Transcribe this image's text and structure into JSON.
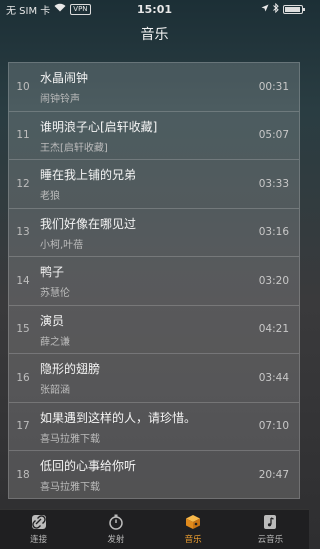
{
  "status": {
    "carrier": "无 SIM 卡",
    "vpn": "VPN",
    "time": "15:01"
  },
  "nav": {
    "title": "音乐"
  },
  "songs": [
    {
      "num": "10",
      "title": "水晶闹钟",
      "artist": "闹钟铃声",
      "duration": "00:31"
    },
    {
      "num": "11",
      "title": "谁明浪子心[启轩收藏]",
      "artist": "王杰[启轩收藏]",
      "duration": "05:07"
    },
    {
      "num": "12",
      "title": "睡在我上铺的兄弟",
      "artist": "老狼",
      "duration": "03:33"
    },
    {
      "num": "13",
      "title": "我们好像在哪见过",
      "artist": "小柯,叶蓓",
      "duration": "03:16"
    },
    {
      "num": "14",
      "title": "鸭子",
      "artist": "苏慧伦",
      "duration": "03:20"
    },
    {
      "num": "15",
      "title": "演员",
      "artist": "薛之谦",
      "duration": "04:21"
    },
    {
      "num": "16",
      "title": "隐形的翅膀",
      "artist": "张韶涵",
      "duration": "03:44"
    },
    {
      "num": "17",
      "title": "如果遇到这样的人，请珍惜。",
      "artist": "喜马拉雅下载",
      "duration": "07:10"
    },
    {
      "num": "18",
      "title": "低回的心事给你听",
      "artist": "喜马拉雅下载",
      "duration": "20:47"
    }
  ],
  "tabs": [
    {
      "label": "连接",
      "icon": "link-icon"
    },
    {
      "label": "发射",
      "icon": "stopwatch-icon"
    },
    {
      "label": "音乐",
      "icon": "music-box-icon"
    },
    {
      "label": "云音乐",
      "icon": "cloud-music-icon"
    }
  ],
  "colors": {
    "accent": "#f0a030",
    "tabbar": "#1f1f21"
  }
}
